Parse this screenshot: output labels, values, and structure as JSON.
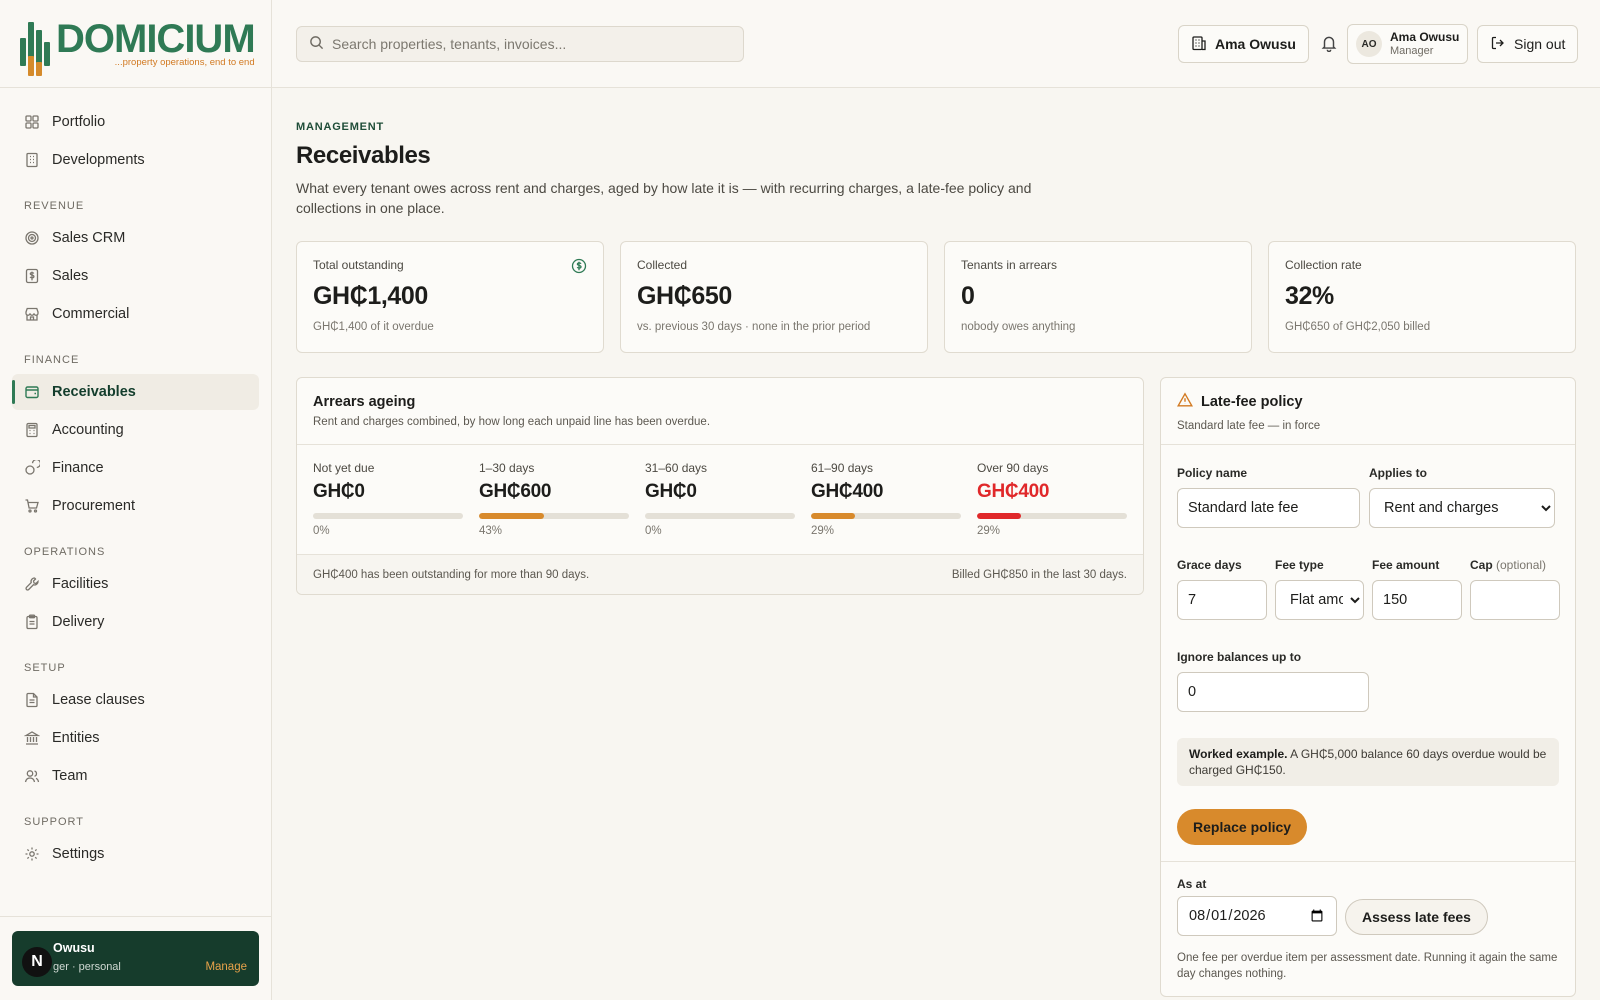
{
  "brand": {
    "name": "DOMICIUM",
    "tagline": "...property operations, end to end"
  },
  "nav": {
    "top": [
      {
        "label": "Portfolio",
        "icon": "grid-icon"
      },
      {
        "label": "Developments",
        "icon": "building-icon"
      }
    ],
    "sections": [
      {
        "title": "REVENUE",
        "items": [
          {
            "label": "Sales CRM",
            "icon": "target-icon"
          },
          {
            "label": "Sales",
            "icon": "dollar-doc-icon"
          },
          {
            "label": "Commercial",
            "icon": "store-icon"
          }
        ]
      },
      {
        "title": "FINANCE",
        "items": [
          {
            "label": "Receivables",
            "icon": "wallet-icon",
            "active": true
          },
          {
            "label": "Accounting",
            "icon": "calculator-icon"
          },
          {
            "label": "Finance",
            "icon": "coins-icon"
          },
          {
            "label": "Procurement",
            "icon": "cart-icon"
          }
        ]
      },
      {
        "title": "OPERATIONS",
        "items": [
          {
            "label": "Facilities",
            "icon": "wrench-icon"
          },
          {
            "label": "Delivery",
            "icon": "clipboard-icon"
          }
        ]
      },
      {
        "title": "SETUP",
        "items": [
          {
            "label": "Lease clauses",
            "icon": "file-text-icon"
          },
          {
            "label": "Entities",
            "icon": "bank-icon"
          },
          {
            "label": "Team",
            "icon": "users-icon"
          }
        ]
      },
      {
        "title": "SUPPORT",
        "items": [
          {
            "label": "Settings",
            "icon": "gear-icon"
          }
        ]
      }
    ]
  },
  "user_card": {
    "badge": "N",
    "name": "Owusu",
    "role": "ger · personal",
    "manage": "Manage"
  },
  "header": {
    "search_placeholder": "Search properties, tenants, invoices...",
    "entity_label": "Ama Owusu",
    "user_initials": "AO",
    "user_name": "Ama Owusu",
    "user_role": "Manager",
    "signout_label": "Sign out"
  },
  "page": {
    "eyebrow": "MANAGEMENT",
    "title": "Receivables",
    "description": "What every tenant owes across rent and charges, aged by how late it is — with recurring charges, a late-fee policy and collections in one place."
  },
  "kpis": [
    {
      "label": "Total outstanding",
      "value": "GH₵1,400",
      "sub": "GH₵1,400 of it overdue"
    },
    {
      "label": "Collected",
      "value": "GH₵650",
      "sub": "vs. previous 30 days · none in the prior period"
    },
    {
      "label": "Tenants in arrears",
      "value": "0",
      "sub": "nobody owes anything"
    },
    {
      "label": "Collection rate",
      "value": "32%",
      "sub": "GH₵650 of GH₵2,050 billed"
    }
  ],
  "ageing": {
    "title": "Arrears ageing",
    "description": "Rent and charges combined, by how long each unpaid line has been overdue.",
    "buckets": [
      {
        "label": "Not yet due",
        "value": "GH₵0",
        "pct_label": "0%",
        "pct": 0,
        "color": "#d88a2c"
      },
      {
        "label": "1–30 days",
        "value": "GH₵600",
        "pct_label": "43%",
        "pct": 43,
        "color": "#d88a2c"
      },
      {
        "label": "31–60 days",
        "value": "GH₵0",
        "pct_label": "0%",
        "pct": 0,
        "color": "#d88a2c"
      },
      {
        "label": "61–90 days",
        "value": "GH₵400",
        "pct_label": "29%",
        "pct": 29,
        "color": "#d88a2c"
      },
      {
        "label": "Over 90 days",
        "value": "GH₵400",
        "pct_label": "29%",
        "pct": 29,
        "color": "#e0282a"
      }
    ],
    "footer_left": "GH₵400 has been outstanding for more than 90 days.",
    "footer_right": "Billed GH₵850 in the last 30 days."
  },
  "policy": {
    "title": "Late-fee policy",
    "subtitle": "Standard late fee — in force",
    "policy_name_label": "Policy name",
    "policy_name_value": "Standard late fee",
    "applies_to_label": "Applies to",
    "applies_to_value": "Rent and charges",
    "grace_days_label": "Grace days",
    "grace_days_value": "7",
    "fee_type_label": "Fee type",
    "fee_type_value": "Flat amount",
    "fee_amount_label": "Fee amount",
    "fee_amount_value": "150",
    "cap_label": "Cap",
    "cap_optional": "(optional)",
    "cap_value": "",
    "ignore_label": "Ignore balances up to",
    "ignore_value": "0",
    "example_bold": "Worked example.",
    "example_text": " A GH₵5,000 balance 60 days overdue would be charged GH₵150.",
    "replace_label": "Replace policy",
    "as_at_label": "As at",
    "as_at_value": "2026-08-01",
    "assess_label": "Assess late fees",
    "assess_note": "One fee per overdue item per assessment date. Running it again the same day changes nothing."
  }
}
